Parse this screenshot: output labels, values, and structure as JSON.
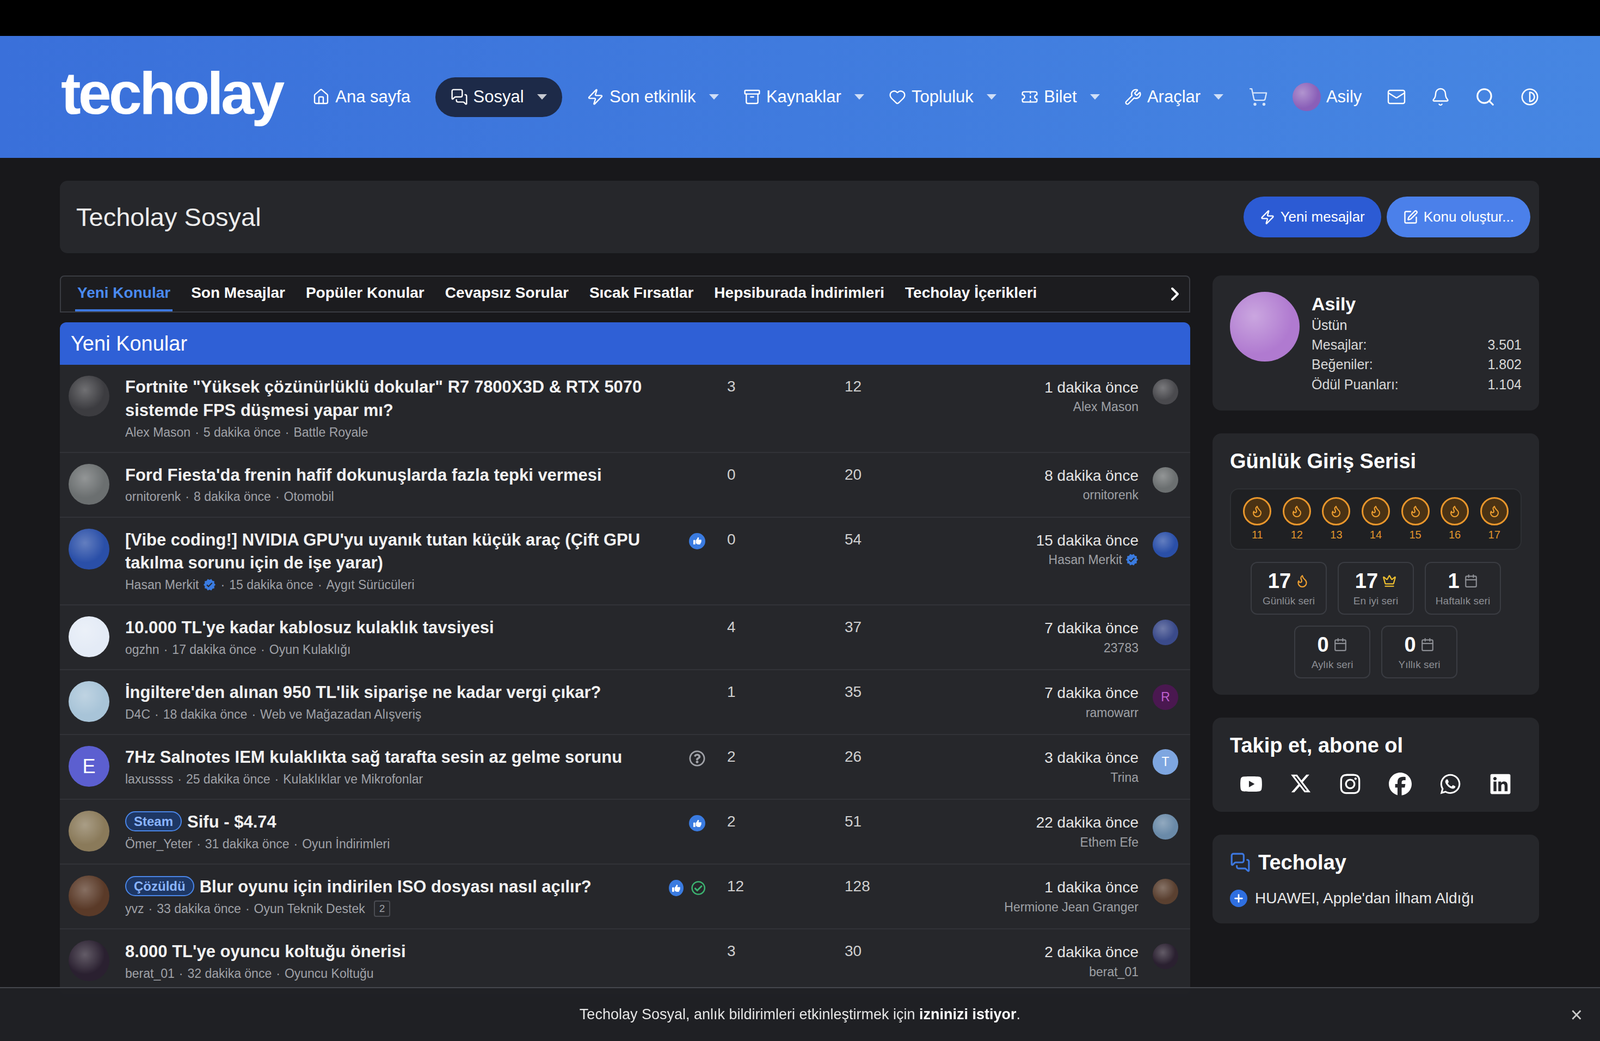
{
  "header": {
    "logo": "techolay",
    "nav": [
      {
        "label": "Ana sayfa",
        "selected": false,
        "dropdown": false
      },
      {
        "label": "Sosyal",
        "selected": true,
        "dropdown": true
      },
      {
        "label": "Son etkinlik",
        "selected": false,
        "dropdown": true
      },
      {
        "label": "Kaynaklar",
        "selected": false,
        "dropdown": true
      },
      {
        "label": "Topluluk",
        "selected": false,
        "dropdown": true
      },
      {
        "label": "Bilet",
        "selected": false,
        "dropdown": true
      },
      {
        "label": "Araçlar",
        "selected": false,
        "dropdown": true
      }
    ],
    "user": {
      "name": "Asily",
      "avatar_color": "#8a5fb8"
    }
  },
  "page": {
    "title": "Techolay Sosyal",
    "buttons": [
      {
        "label": "Yeni mesajlar",
        "kind": "secondary"
      },
      {
        "label": "Konu oluştur...",
        "kind": "primary"
      }
    ]
  },
  "tabs": [
    {
      "label": "Yeni Konular",
      "selected": true
    },
    {
      "label": "Son Mesajlar",
      "selected": false
    },
    {
      "label": "Popüler Konular",
      "selected": false
    },
    {
      "label": "Cevapsız Sorular",
      "selected": false
    },
    {
      "label": "Sıcak Fırsatlar",
      "selected": false
    },
    {
      "label": "Hepsiburada İndirimleri",
      "selected": false
    },
    {
      "label": "Techolay İçerikleri",
      "selected": false
    }
  ],
  "list": {
    "title": "Yeni Konular",
    "separator": "·",
    "rows": [
      {
        "prefix": null,
        "title": "Fortnite \"Yüksek çözünürlüklü dokular\" R7 7800X3D & RTX 5070 sistemde FPS düşmesi yapar mı?",
        "author": "Alex Mason",
        "author_verified": false,
        "time": "5 dakika önce",
        "forum": "Battle Royale",
        "pages": null,
        "liked": false,
        "question": false,
        "solved": false,
        "replies": "3",
        "views": "12",
        "last_time": "1 dakika önce",
        "last_user": "Alex Mason",
        "last_verified": false,
        "avatar": {
          "kind": "photo",
          "color": "#3c3c40",
          "letter": null,
          "letter_color": null
        },
        "last_avatar": {
          "kind": "photo",
          "color": "#4a4a4e",
          "letter": null,
          "letter_color": null
        }
      },
      {
        "prefix": null,
        "title": "Ford Fiesta'da frenin hafif dokunuşlarda fazla tepki vermesi",
        "author": "ornitorenk",
        "author_verified": false,
        "time": "8 dakika önce",
        "forum": "Otomobil",
        "pages": null,
        "liked": false,
        "question": false,
        "solved": false,
        "replies": "0",
        "views": "20",
        "last_time": "8 dakika önce",
        "last_user": "ornitorenk",
        "last_verified": false,
        "avatar": {
          "kind": "photo",
          "color": "#6b6f70",
          "letter": null,
          "letter_color": null
        },
        "last_avatar": {
          "kind": "photo",
          "color": "#6b6f70",
          "letter": null,
          "letter_color": null
        }
      },
      {
        "prefix": null,
        "title": "[Vibe coding!] NVIDIA GPU'yu uyanık tutan küçük araç (Çift GPU takılma sorunu için de işe yarar)",
        "author": "Hasan Merkit",
        "author_verified": true,
        "time": "15 dakika önce",
        "forum": "Aygıt Sürücüleri",
        "pages": null,
        "liked": true,
        "question": false,
        "solved": false,
        "replies": "0",
        "views": "54",
        "last_time": "15 dakika önce",
        "last_user": "Hasan Merkit",
        "last_verified": true,
        "avatar": {
          "kind": "photo",
          "color": "#2a4fa8",
          "letter": null,
          "letter_color": null
        },
        "last_avatar": {
          "kind": "photo",
          "color": "#2a4fa8",
          "letter": null,
          "letter_color": null
        }
      },
      {
        "prefix": null,
        "title": "10.000 TL'ye kadar kablosuz kulaklık tavsiyesi",
        "author": "ogzhn",
        "author_verified": false,
        "time": "17 dakika önce",
        "forum": "Oyun Kulaklığı",
        "pages": null,
        "liked": false,
        "question": false,
        "solved": false,
        "replies": "4",
        "views": "37",
        "last_time": "7 dakika önce",
        "last_user": "23783",
        "last_verified": false,
        "avatar": {
          "kind": "photo",
          "color": "#e4ebf6",
          "letter": null,
          "letter_color": null
        },
        "last_avatar": {
          "kind": "photo",
          "color": "#3a4a8a",
          "letter": null,
          "letter_color": null
        }
      },
      {
        "prefix": null,
        "title": "İngiltere'den alınan 950 TL'lik siparişe ne kadar vergi çıkar?",
        "author": "D4C",
        "author_verified": false,
        "time": "18 dakika önce",
        "forum": "Web ve Mağazadan Alışveriş",
        "pages": null,
        "liked": false,
        "question": false,
        "solved": false,
        "replies": "1",
        "views": "35",
        "last_time": "7 dakika önce",
        "last_user": "ramowarr",
        "last_verified": false,
        "avatar": {
          "kind": "photo",
          "color": "#a8c4d8",
          "letter": null,
          "letter_color": null
        },
        "last_avatar": {
          "kind": "letter",
          "color": "#4a1850",
          "letter": "R",
          "letter_color": "#c060d0"
        }
      },
      {
        "prefix": null,
        "title": "7Hz Salnotes IEM kulaklıkta sağ tarafta sesin az gelme sorunu",
        "author": "laxussss",
        "author_verified": false,
        "time": "25 dakika önce",
        "forum": "Kulaklıklar ve Mikrofonlar",
        "pages": null,
        "liked": false,
        "question": true,
        "solved": false,
        "replies": "2",
        "views": "26",
        "last_time": "3 dakika önce",
        "last_user": "Trina",
        "last_verified": false,
        "avatar": {
          "kind": "letter",
          "color": "#5c5fd0",
          "letter": "E",
          "letter_color": "#ffffff"
        },
        "last_avatar": {
          "kind": "letter",
          "color": "#7ea6e0",
          "letter": "T",
          "letter_color": "#ffffff"
        }
      },
      {
        "prefix": "Steam",
        "title": "Sifu - $4.74",
        "author": "Ömer_Yeter",
        "author_verified": false,
        "time": "31 dakika önce",
        "forum": "Oyun İndirimleri",
        "pages": null,
        "liked": true,
        "question": false,
        "solved": false,
        "replies": "2",
        "views": "51",
        "last_time": "22 dakika önce",
        "last_user": "Ethem Efe",
        "last_verified": false,
        "avatar": {
          "kind": "photo",
          "color": "#8a7a5a",
          "letter": null,
          "letter_color": null
        },
        "last_avatar": {
          "kind": "photo",
          "color": "#6a8aa8",
          "letter": null,
          "letter_color": null
        }
      },
      {
        "prefix": "Çözüldü",
        "title": "Blur oyunu için indirilen ISO dosyası nasıl açılır?",
        "author": "yvz",
        "author_verified": false,
        "time": "33 dakika önce",
        "forum": "Oyun Teknik Destek",
        "pages": "2",
        "liked": true,
        "question": false,
        "solved": true,
        "replies": "12",
        "views": "128",
        "last_time": "1 dakika önce",
        "last_user": "Hermione Jean Granger",
        "last_verified": false,
        "avatar": {
          "kind": "photo",
          "color": "#5a3a28",
          "letter": null,
          "letter_color": null
        },
        "last_avatar": {
          "kind": "photo",
          "color": "#5a4030",
          "letter": null,
          "letter_color": null
        }
      },
      {
        "prefix": null,
        "title": "8.000 TL'ye oyuncu koltuğu önerisi",
        "author": "berat_01",
        "author_verified": false,
        "time": "32 dakika önce",
        "forum": "Oyuncu Koltuğu",
        "pages": null,
        "liked": false,
        "question": false,
        "solved": false,
        "replies": "3",
        "views": "30",
        "last_time": "2 dakika önce",
        "last_user": "berat_01",
        "last_verified": false,
        "avatar": {
          "kind": "photo",
          "color": "#2a2030",
          "letter": null,
          "letter_color": null
        },
        "last_avatar": {
          "kind": "photo",
          "color": "#2a2030",
          "letter": null,
          "letter_color": null
        }
      }
    ]
  },
  "profile": {
    "name": "Asily",
    "rank": "Üstün",
    "avatar_color": "#b07ad0",
    "stats": [
      {
        "label": "Mesajlar:",
        "value": "3.501"
      },
      {
        "label": "Beğeniler:",
        "value": "1.802"
      },
      {
        "label": "Ödül Puanları:",
        "value": "1.104"
      }
    ]
  },
  "streak": {
    "title": "Günlük Giriş Serisi",
    "days": [
      {
        "label": "11",
        "done": true
      },
      {
        "label": "12",
        "done": true
      },
      {
        "label": "13",
        "done": true
      },
      {
        "label": "14",
        "done": true
      },
      {
        "label": "15",
        "done": true
      },
      {
        "label": "16",
        "done": true
      },
      {
        "label": "17",
        "done": true
      }
    ],
    "stats": [
      {
        "value": "17",
        "label": "Günlük seri"
      },
      {
        "value": "17",
        "label": "En iyi seri"
      },
      {
        "value": "1",
        "label": "Haftalık seri"
      },
      {
        "value": "0",
        "label": "Aylık seri"
      },
      {
        "value": "0",
        "label": "Yıllık seri"
      }
    ]
  },
  "follow": {
    "title": "Takip et, abone ol"
  },
  "feed": {
    "title": "Techolay",
    "items": [
      "HUAWEI, Apple'dan İlham Aldığı"
    ]
  },
  "notice": {
    "text": "Techolay Sosyal, anlık bildirimleri etkinleştirmek için ",
    "bold": "izninizi istiyor",
    "end": ".",
    "close": "×"
  }
}
